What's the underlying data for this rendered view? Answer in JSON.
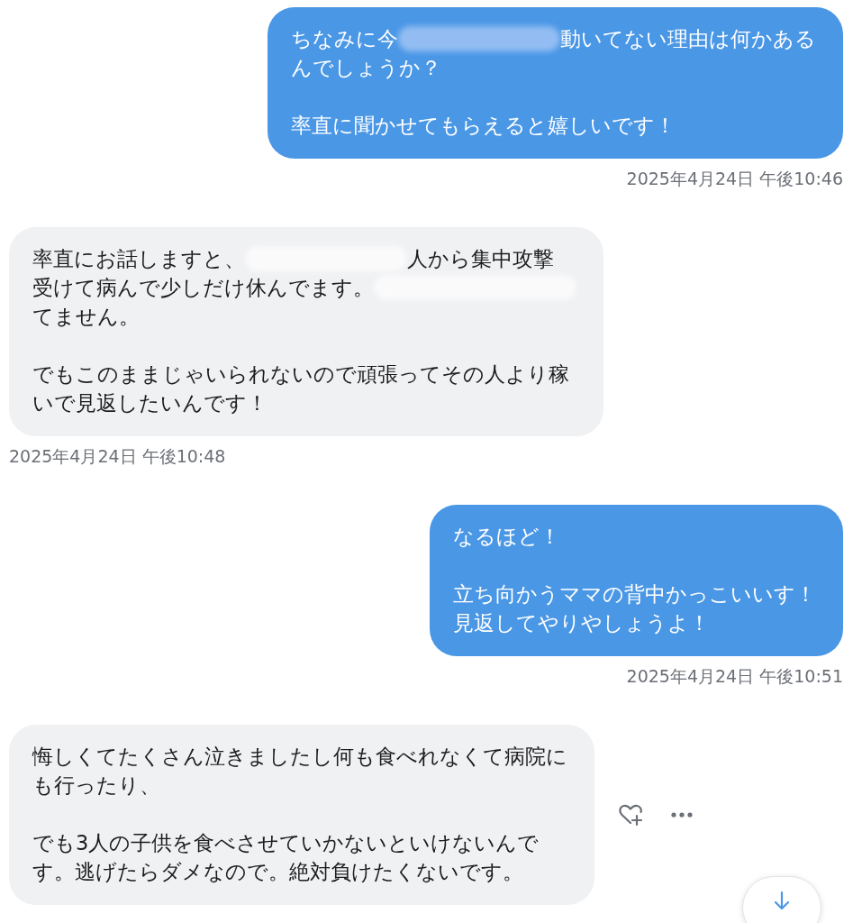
{
  "messages": [
    {
      "outgoing": true,
      "paragraphs": [
        [
          [
            {
              "kind": "text",
              "text": "ちなみに今"
            },
            {
              "kind": "redacted"
            },
            {
              "kind": "text",
              "text": "動いてない理由は何かある"
            }
          ],
          [
            {
              "kind": "text",
              "text": "んでしょうか？"
            }
          ]
        ],
        [
          [
            {
              "kind": "text",
              "text": "率直に聞かせてもらえると嬉しいです！"
            }
          ]
        ]
      ],
      "time": "2025年4月24日 午後10:46"
    },
    {
      "outgoing": false,
      "paragraphs": [
        [
          [
            {
              "kind": "text",
              "text": "率直にお話しますと、"
            },
            {
              "kind": "redacted"
            },
            {
              "kind": "text",
              "text": "人から集中攻撃"
            }
          ],
          [
            {
              "kind": "text",
              "text": "受けて病んで少しだけ休んでます。"
            },
            {
              "kind": "redacted"
            }
          ],
          [
            {
              "kind": "text",
              "text": "てません。"
            }
          ]
        ],
        [
          [
            {
              "kind": "text",
              "text": "でもこのままじゃいられないので頑張ってその人より稼"
            }
          ],
          [
            {
              "kind": "text",
              "text": "いで見返したいんです！"
            }
          ]
        ]
      ],
      "time": "2025年4月24日 午後10:48"
    },
    {
      "outgoing": true,
      "paragraphs": [
        [
          [
            {
              "kind": "text",
              "text": "なるほど！"
            }
          ]
        ],
        [
          [
            {
              "kind": "text",
              "text": "立ち向かうママの背中かっこいいす！"
            }
          ],
          [
            {
              "kind": "text",
              "text": "見返してやりやしょうよ！"
            }
          ]
        ]
      ],
      "time": "2025年4月24日 午後10:51"
    },
    {
      "outgoing": false,
      "paragraphs": [
        [
          [
            {
              "kind": "text",
              "text": "悔しくてたくさん泣きましたし何も食べれなくて病院に"
            }
          ],
          [
            {
              "kind": "text",
              "text": "も行ったり、"
            }
          ]
        ],
        [
          [
            {
              "kind": "text",
              "text": "でも3人の子供を食べさせていかないといけないんで"
            }
          ],
          [
            {
              "kind": "text",
              "text": "す。逃げたらダメなので。絶対負けたくないです。"
            }
          ]
        ]
      ],
      "actions": true
    }
  ],
  "scroll_down_button": true
}
